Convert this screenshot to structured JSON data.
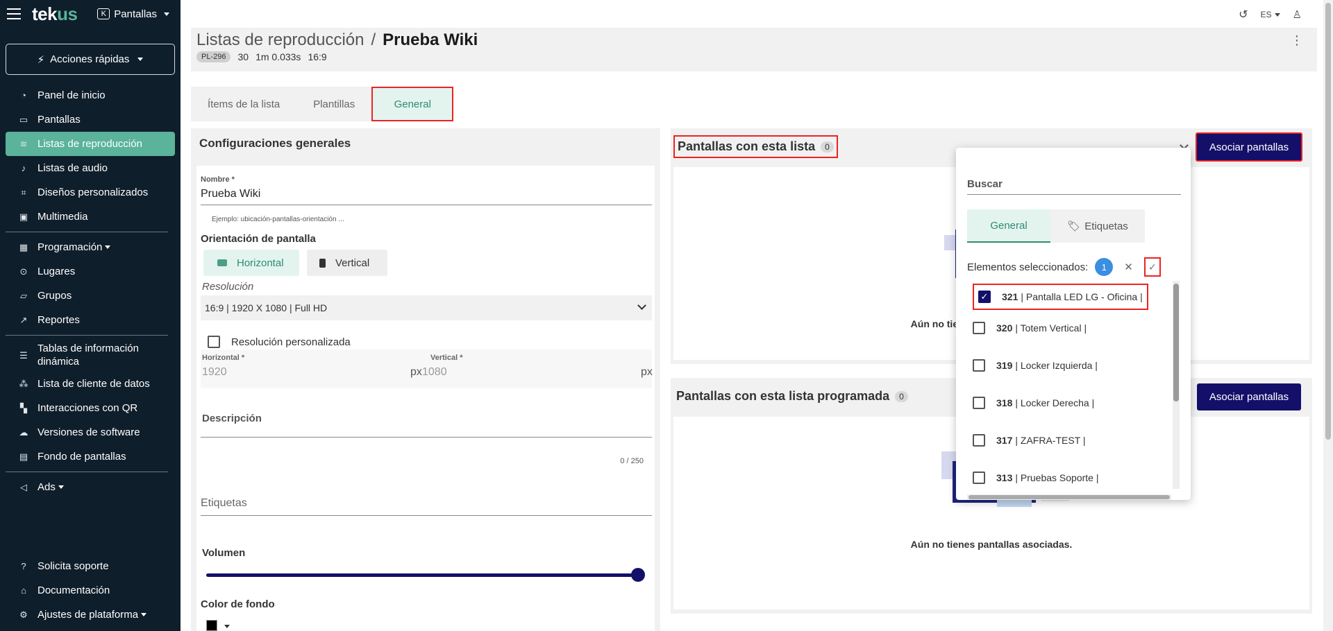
{
  "sidebar": {
    "logo_main": "tek",
    "logo_accent": "us",
    "app_switch_letter": "K",
    "app_switch_label": "Pantallas",
    "quick_actions": "Acciones rápidas",
    "items": [
      {
        "label": "Panel de inicio",
        "icon": "dashboard-icon"
      },
      {
        "label": "Pantallas",
        "icon": "monitor-icon"
      },
      {
        "label": "Listas de reproducción",
        "icon": "layers-icon"
      },
      {
        "label": "Listas de audio",
        "icon": "music-icon"
      },
      {
        "label": "Diseños personalizados",
        "icon": "layout-icon"
      },
      {
        "label": "Multimedia",
        "icon": "image-icon"
      },
      {
        "label": "Programación",
        "icon": "calendar-icon"
      },
      {
        "label": "Lugares",
        "icon": "pin-icon"
      },
      {
        "label": "Grupos",
        "icon": "folder-icon"
      },
      {
        "label": "Reportes",
        "icon": "chart-icon"
      },
      {
        "label": "Tablas de información dinámica",
        "icon": "table-icon"
      },
      {
        "label": "Lista de cliente de datos",
        "icon": "data-icon"
      },
      {
        "label": "Interacciones con QR",
        "icon": "qr-icon"
      },
      {
        "label": "Versiones de software",
        "icon": "cloud-icon"
      },
      {
        "label": "Fondo de pantallas",
        "icon": "wallpaper-icon"
      },
      {
        "label": "Ads",
        "icon": "megaphone-icon"
      }
    ],
    "bottom": [
      {
        "label": "Solicita soporte",
        "icon": "help-icon"
      },
      {
        "label": "Documentación",
        "icon": "docs-icon"
      },
      {
        "label": "Ajustes de plataforma",
        "icon": "settings-icon"
      }
    ]
  },
  "topbar": {
    "language": "ES"
  },
  "header": {
    "section": "Listas de reproducción",
    "separator": "/",
    "title": "Prueba Wiki",
    "code": "PL-296",
    "items": "30",
    "duration": "1m 0.033s",
    "ratio": "16:9"
  },
  "tabs": [
    "Ítems de la lista",
    "Plantillas",
    "General"
  ],
  "config": {
    "title": "Configuraciones generales",
    "name_label": "Nombre",
    "name_value": "Prueba Wiki",
    "name_hint": "Ejemplo: ubicación-pantallas-orientación ...",
    "orientation_label": "Orientación de pantalla",
    "horizontal": "Horizontal",
    "vertical": "Vertical",
    "resolution_label": "Resolución",
    "resolution_value": "16:9 | 1920 X 1080 | Full HD",
    "custom_resolution": "Resolución personalizada",
    "horizontal_label": "Horizontal",
    "horizontal_value": "1920",
    "vertical_label": "Vertical",
    "vertical_value": "1080",
    "unit": "px",
    "description_label": "Descripción",
    "description_counter": "0 / 250",
    "tags_label": "Etiquetas",
    "volume_label": "Volumen",
    "volume_level": 1.0,
    "bg_color_label": "Color de fondo",
    "bg_color": "#000000"
  },
  "panel1": {
    "title": "Pantallas con esta lista",
    "count": "0",
    "button": "Asociar pantallas",
    "empty": "Aún no tienes pantallas asociadas."
  },
  "panel2": {
    "title": "Pantallas con esta lista programada",
    "count": "0",
    "button": "Asociar pantallas",
    "empty": "Aún no tienes pantallas asociadas."
  },
  "popup": {
    "search_label": "Buscar",
    "tab_general": "General",
    "tab_tags": "Etiquetas",
    "selected_label": "Elementos seleccionados:",
    "selected_count": "1",
    "rows": [
      {
        "id": "321",
        "name": "| Pantalla LED LG - Oficina |",
        "checked": true
      },
      {
        "id": "320",
        "name": "| Totem Vertical |",
        "checked": false
      },
      {
        "id": "319",
        "name": "| Locker Izquierda |",
        "checked": false
      },
      {
        "id": "318",
        "name": "| Locker Derecha |",
        "checked": false
      },
      {
        "id": "317",
        "name": "| ZAFRA-TEST |",
        "checked": false
      },
      {
        "id": "313",
        "name": "| Pruebas Soporte |",
        "checked": false
      }
    ]
  },
  "colors": {
    "sidebar": "#0f1e2b",
    "accent": "#5ab39a",
    "primary": "#14106a",
    "highlight": "#ee2222"
  }
}
